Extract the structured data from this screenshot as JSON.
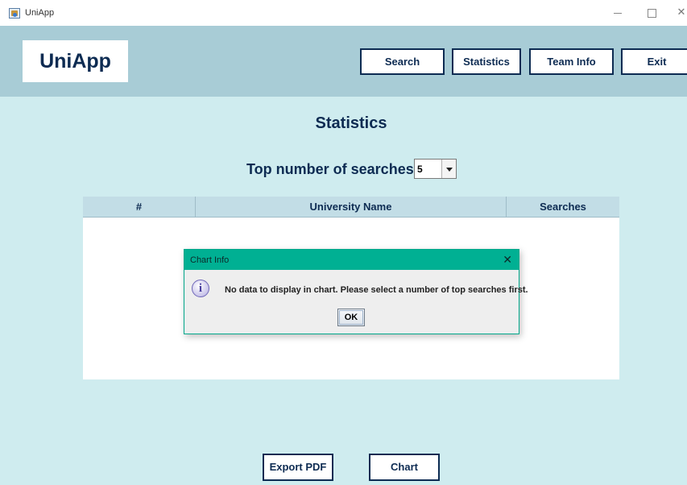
{
  "window": {
    "title": "UniApp",
    "close_glyph": "✕"
  },
  "header": {
    "logo": "UniApp",
    "nav": {
      "search": "Search",
      "statistics": "Statistics",
      "team_info": "Team Info",
      "exit": "Exit"
    }
  },
  "main": {
    "title": "Statistics",
    "top_label": "Top number of searches:",
    "top_selected": "5"
  },
  "table": {
    "columns": [
      "#",
      "University Name",
      "Searches"
    ],
    "rows": []
  },
  "dialog": {
    "title": "Chart Info",
    "icon": "info-icon",
    "icon_glyph": "i",
    "message": "No data to display in chart. Please select a number of top searches first.",
    "ok_label": "OK",
    "close_glyph": "✕"
  },
  "actions": {
    "export_pdf": "Export PDF",
    "chart": "Chart"
  },
  "colors": {
    "navy": "#0d2b52",
    "header_bg": "#a8ccd6",
    "page_bg": "#cfecef",
    "dialog_title_bg": "#00b093"
  }
}
